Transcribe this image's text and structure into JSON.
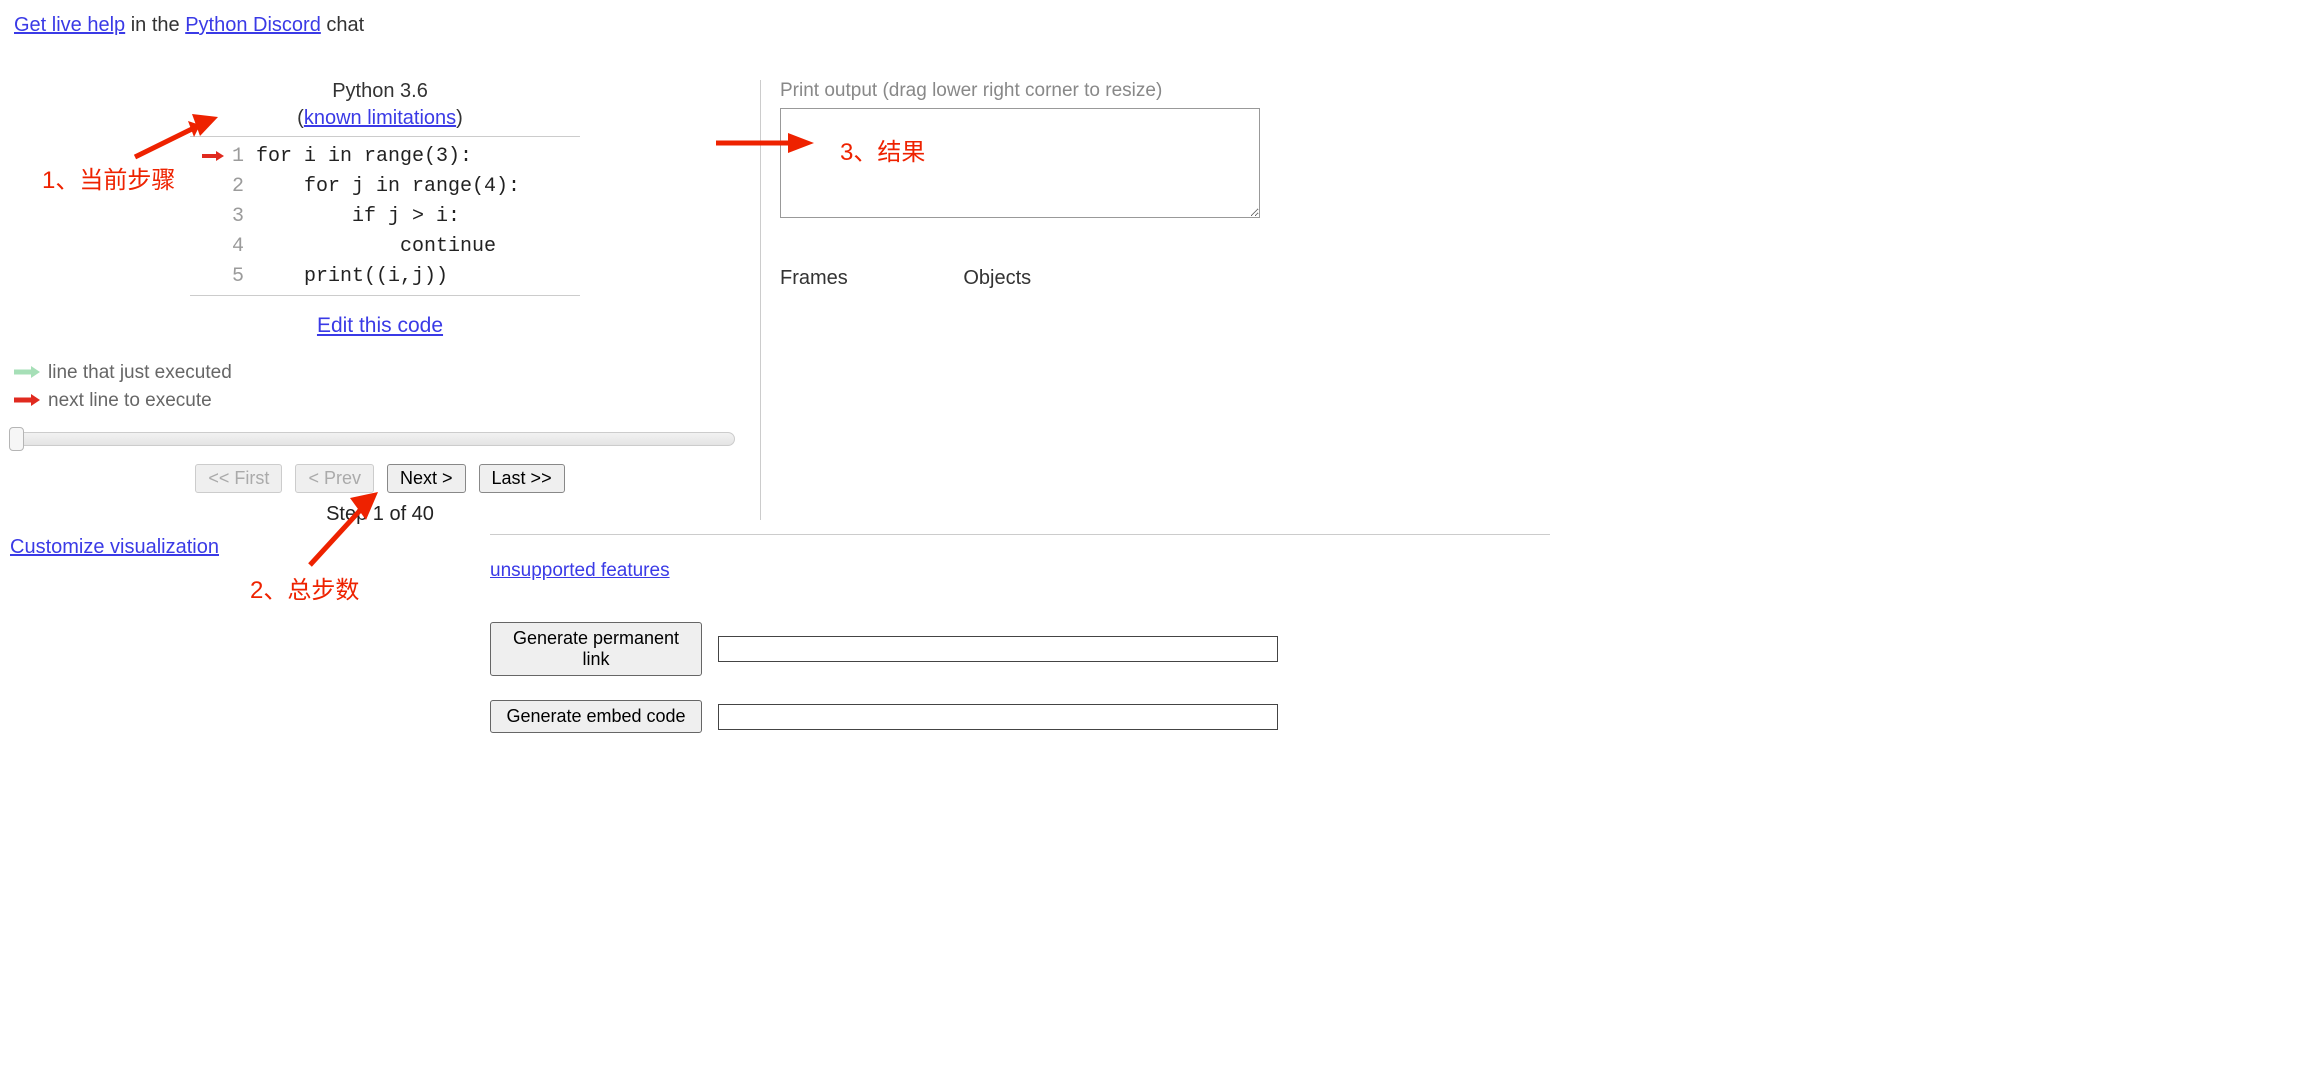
{
  "header": {
    "get_help": "Get live help",
    "in_the": " in the ",
    "discord": "Python Discord",
    "chat": " chat"
  },
  "code_panel": {
    "python_version": "Python 3.6",
    "limitations_prefix": "(",
    "limitations_link": "known limitations",
    "limitations_suffix": ")",
    "lines": [
      {
        "n": "1",
        "text": "for i in range(3):",
        "next": true
      },
      {
        "n": "2",
        "text": "    for j in range(4):",
        "next": false
      },
      {
        "n": "3",
        "text": "        if j > i:",
        "next": false
      },
      {
        "n": "4",
        "text": "            continue",
        "next": false
      },
      {
        "n": "5",
        "text": "    print((i,j))",
        "next": false
      }
    ],
    "edit_link": "Edit this code"
  },
  "legend": {
    "executed": "line that just executed",
    "next": "next line to execute"
  },
  "nav": {
    "first": "<< First",
    "prev": "< Prev",
    "next": "Next >",
    "last": "Last >>",
    "step_text": "Step 1 of 40"
  },
  "customize_link": "Customize visualization",
  "output": {
    "label": "Print output (drag lower right corner to resize)",
    "value": ""
  },
  "frames_label": "Frames",
  "objects_label": "Objects",
  "unsupported_link": "unsupported features",
  "gen": {
    "permalink_btn": "Generate permanent link",
    "embed_btn": "Generate embed code",
    "permalink_val": "",
    "embed_val": ""
  },
  "annotations": {
    "a1": "1、当前步骤",
    "a2": "2、总步数",
    "a3": "3、结果"
  }
}
